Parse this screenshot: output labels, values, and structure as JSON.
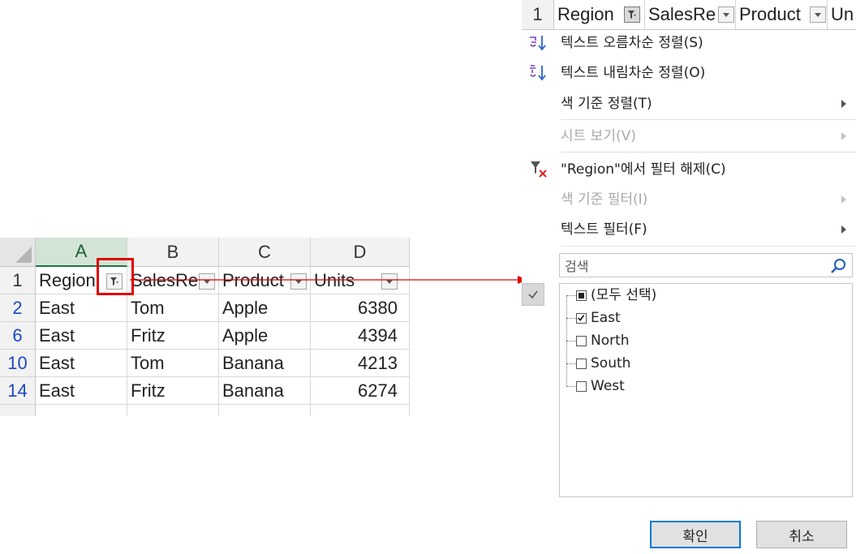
{
  "sheet": {
    "columns": [
      "A",
      "B",
      "C",
      "D"
    ],
    "header_row_number": "1",
    "headers": [
      "Region",
      "SalesRe",
      "Product",
      "Units"
    ],
    "rows": [
      {
        "num": "2",
        "cells": [
          "East",
          "Tom",
          "Apple",
          "6380"
        ]
      },
      {
        "num": "6",
        "cells": [
          "East",
          "Fritz",
          "Apple",
          "4394"
        ]
      },
      {
        "num": "10",
        "cells": [
          "East",
          "Tom",
          "Banana",
          "4213"
        ]
      },
      {
        "num": "14",
        "cells": [
          "East",
          "Fritz",
          "Banana",
          "6274"
        ]
      }
    ],
    "selected_column": "A",
    "colors": {
      "selected_header": "#d2e4d5",
      "row_link": "#1a47c4",
      "highlight_box": "#e00000"
    }
  },
  "panel": {
    "header_row_number": "1",
    "headers": [
      "Region",
      "SalesRe",
      "Product",
      "Un"
    ],
    "menu": {
      "sort_asc": "텍스트 오름차순 정렬(S)",
      "sort_desc": "텍스트 내림차순 정렬(O)",
      "sort_by_color": "색 기준 정렬(T)",
      "sheet_view": "시트 보기(V)",
      "clear_filter": "\"Region\"에서 필터 해제(C)",
      "filter_by_color": "색 기준 필터(I)",
      "text_filter": "텍스트 필터(F)"
    },
    "icons": {
      "sort_asc": "sort-ascending-icon",
      "sort_desc": "sort-descending-icon",
      "clear_filter": "clear-filter-icon",
      "search": "magnifier-icon"
    },
    "search": {
      "placeholder": "검색",
      "value": ""
    },
    "list": {
      "select_all": "(모두 선택)",
      "items": [
        {
          "label": "East",
          "checked": true
        },
        {
          "label": "North",
          "checked": false
        },
        {
          "label": "South",
          "checked": false
        },
        {
          "label": "West",
          "checked": false
        }
      ]
    },
    "buttons": {
      "ok": "확인",
      "cancel": "취소"
    },
    "colors": {
      "ok_border": "#0078d7",
      "disabled_text": "#a9a9a9"
    }
  }
}
